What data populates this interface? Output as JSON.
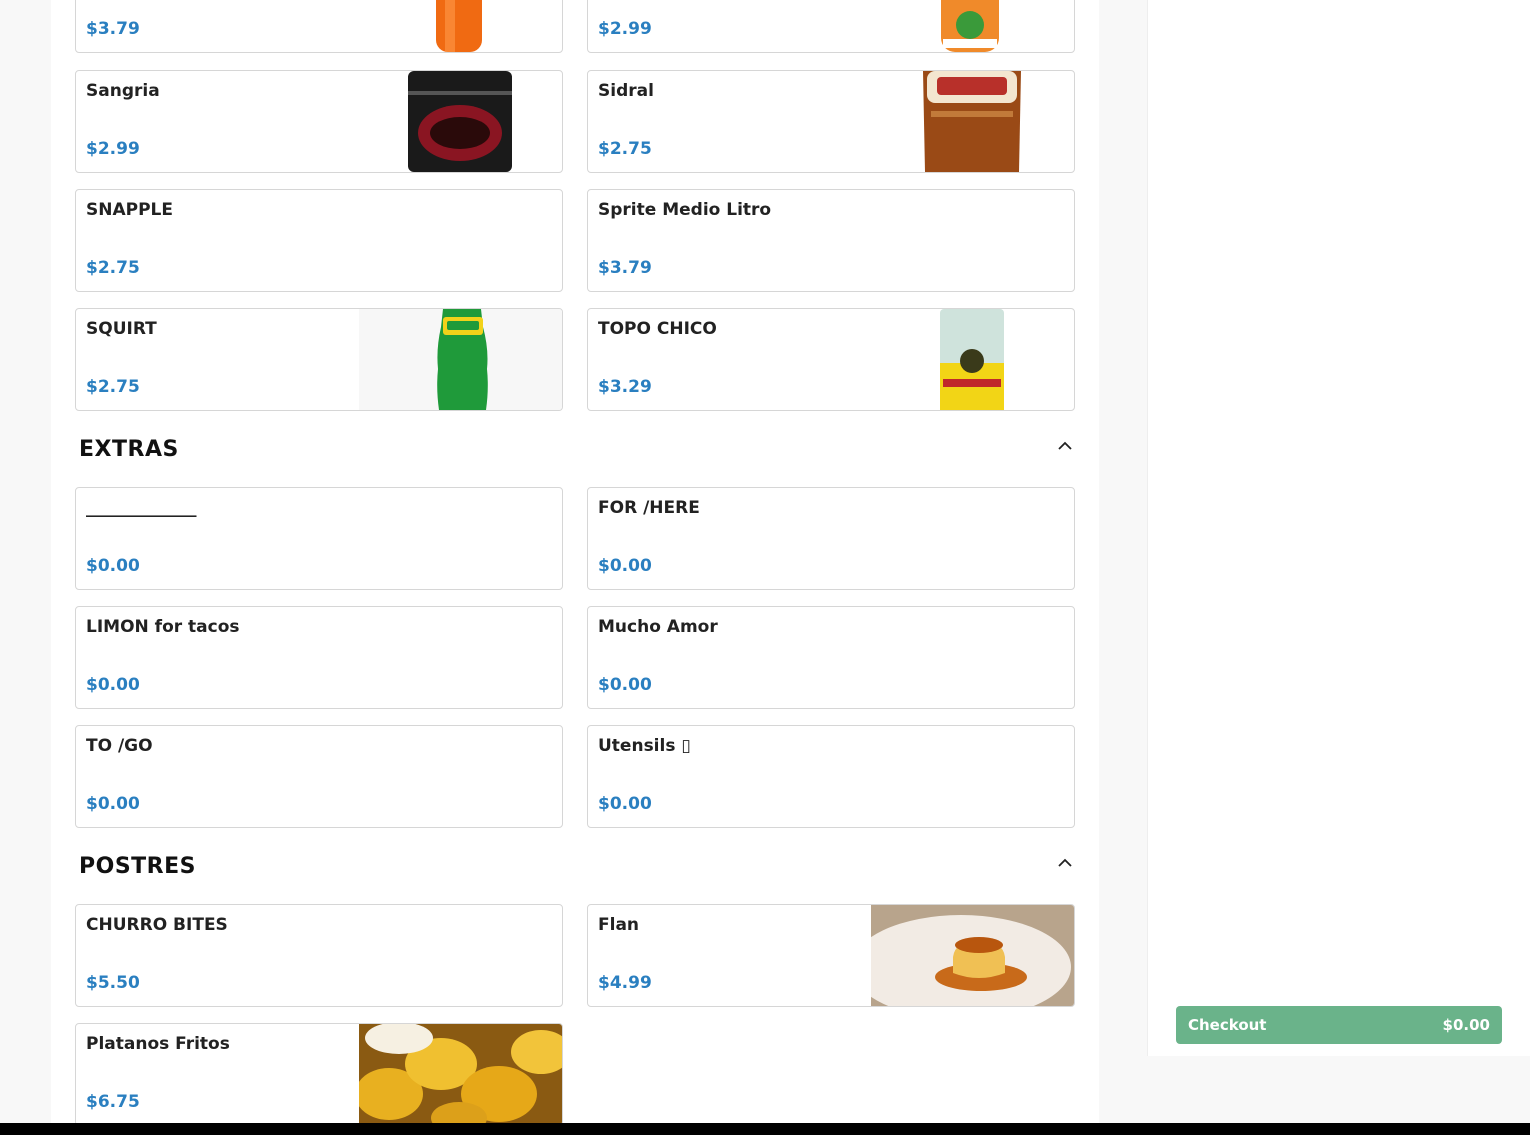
{
  "sections": {
    "refrescos_tail": {
      "items": [
        {
          "name": "",
          "price": "$3.79"
        },
        {
          "name": "",
          "price": "$2.99"
        },
        {
          "name": "Sangria",
          "price": "$2.99"
        },
        {
          "name": "Sidral",
          "price": "$2.75"
        },
        {
          "name": "SNAPPLE",
          "price": "$2.75"
        },
        {
          "name": "Sprite Medio Litro",
          "price": "$3.79"
        },
        {
          "name": "SQUIRT",
          "price": "$2.75"
        },
        {
          "name": "TOPO CHICO",
          "price": "$3.29"
        }
      ]
    },
    "extras": {
      "title": "EXTRAS",
      "items": [
        {
          "name": "_____________",
          "price": "$0.00"
        },
        {
          "name": "FOR /HERE",
          "price": "$0.00"
        },
        {
          "name": "LIMON for tacos",
          "price": "$0.00"
        },
        {
          "name": "Mucho Amor",
          "price": "$0.00"
        },
        {
          "name": "TO /GO",
          "price": "$0.00"
        },
        {
          "name": "Utensils ▯",
          "price": "$0.00"
        }
      ]
    },
    "postres": {
      "title": "POSTRES",
      "items": [
        {
          "name": "CHURRO BITES",
          "price": "$5.50"
        },
        {
          "name": "Flan",
          "price": "$4.99"
        },
        {
          "name": "Platanos Fritos",
          "price": "$6.75"
        }
      ]
    }
  },
  "cart": {
    "checkout_label": "Checkout",
    "checkout_total": "$0.00"
  },
  "colors": {
    "price": "#2a7fc0",
    "checkout": "#6ab38a"
  },
  "icons": {
    "section_toggle": "chevron-up-icon"
  }
}
